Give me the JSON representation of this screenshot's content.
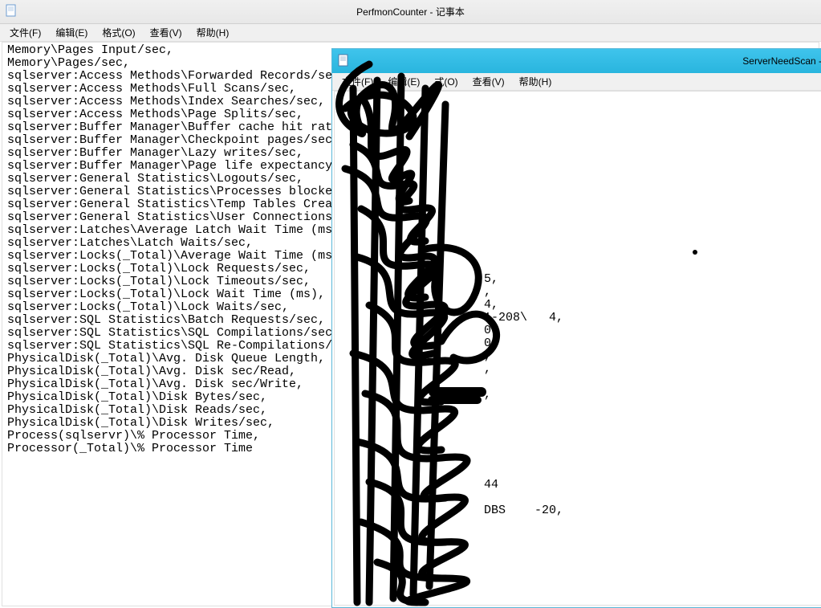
{
  "main_window": {
    "title": "PerfmonCounter - 记事本",
    "menu": {
      "file": "文件(F)",
      "edit": "编辑(E)",
      "format": "格式(O)",
      "view": "查看(V)",
      "help": "帮助(H)"
    },
    "content_lines": [
      "Memory\\Pages Input/sec,",
      "Memory\\Pages/sec,",
      "sqlserver:Access Methods\\Forwarded Records/sec,",
      "sqlserver:Access Methods\\Full Scans/sec,",
      "sqlserver:Access Methods\\Index Searches/sec,",
      "sqlserver:Access Methods\\Page Splits/sec,",
      "sqlserver:Buffer Manager\\Buffer cache hit ratio,",
      "sqlserver:Buffer Manager\\Checkpoint pages/sec,",
      "sqlserver:Buffer Manager\\Lazy writes/sec,",
      "sqlserver:Buffer Manager\\Page life expectancy,",
      "sqlserver:General Statistics\\Logouts/sec,",
      "sqlserver:General Statistics\\Processes blocked,",
      "sqlserver:General Statistics\\Temp Tables Creation R",
      "sqlserver:General Statistics\\User Connections,",
      "sqlserver:Latches\\Average Latch Wait Time (ms),",
      "sqlserver:Latches\\Latch Waits/sec,",
      "sqlserver:Locks(_Total)\\Average Wait Time (ms),",
      "sqlserver:Locks(_Total)\\Lock Requests/sec,",
      "sqlserver:Locks(_Total)\\Lock Timeouts/sec,",
      "sqlserver:Locks(_Total)\\Lock Wait Time (ms),",
      "sqlserver:Locks(_Total)\\Lock Waits/sec,",
      "sqlserver:SQL Statistics\\Batch Requests/sec,",
      "sqlserver:SQL Statistics\\SQL Compilations/sec,",
      "sqlserver:SQL Statistics\\SQL Re-Compilations/sec,",
      "PhysicalDisk(_Total)\\Avg. Disk Queue Length,",
      "PhysicalDisk(_Total)\\Avg. Disk sec/Read,",
      "PhysicalDisk(_Total)\\Avg. Disk sec/Write,",
      "PhysicalDisk(_Total)\\Disk Bytes/sec,",
      "PhysicalDisk(_Total)\\Disk Reads/sec,",
      "PhysicalDisk(_Total)\\Disk Writes/sec,",
      "Process(sqlservr)\\% Processor Time,",
      "Processor(_Total)\\% Processor Time"
    ]
  },
  "secondary_window": {
    "title": "ServerNeedScan -",
    "menu": {
      "file": "文件(F)",
      "edit": "编辑(E)",
      "format": "式(O)",
      "view": "查看(V)",
      "help": "帮助(H)"
    },
    "visible_fragments": [
      "5,",
      ",",
      "4,",
      "1-208\\   4,",
      "0,",
      "0,",
      ",",
      ",",
      "",
      ",",
      "",
      "",
      "",
      "",
      "",
      "",
      "44",
      "",
      "DBS    -20,"
    ]
  }
}
